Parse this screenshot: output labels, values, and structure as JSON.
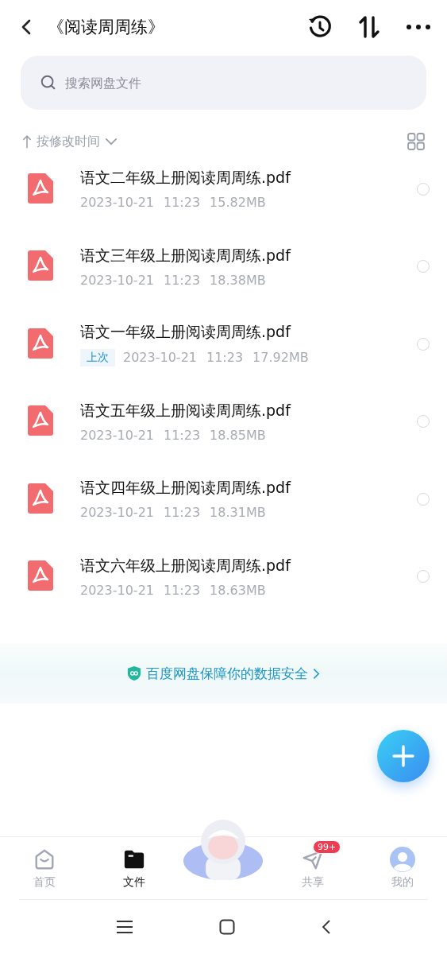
{
  "header": {
    "title": "《阅读周周练》"
  },
  "search": {
    "placeholder": "搜索网盘文件"
  },
  "sort": {
    "label": "按修改时间"
  },
  "files": [
    {
      "name": "语文二年级上册阅读周周练.pdf",
      "date": "2023-10-21",
      "time": "11:23",
      "size": "15.82MB",
      "selected": false
    },
    {
      "name": "语文三年级上册阅读周周练.pdf",
      "date": "2023-10-21",
      "time": "11:23",
      "size": "18.38MB",
      "selected": false
    },
    {
      "name": "语文一年级上册阅读周周练.pdf",
      "tag": "上次",
      "date": "2023-10-21",
      "time": "11:23",
      "size": "17.92MB",
      "selected": false
    },
    {
      "name": "语文五年级上册阅读周周练.pdf",
      "date": "2023-10-21",
      "time": "11:23",
      "size": "18.85MB",
      "selected": false
    },
    {
      "name": "语文四年级上册阅读周周练.pdf",
      "date": "2023-10-21",
      "time": "11:23",
      "size": "18.31MB",
      "selected": false
    },
    {
      "name": "语文六年级上册阅读周周练.pdf",
      "date": "2023-10-21",
      "time": "11:23",
      "size": "18.63MB",
      "selected": false
    }
  ],
  "banner": {
    "text": "百度网盘保障你的数据安全"
  },
  "nav": [
    {
      "kind": "tab",
      "label": "首页",
      "selected": false
    },
    {
      "kind": "tab",
      "label": "文件",
      "selected": true
    },
    {
      "kind": "mascot"
    },
    {
      "kind": "tab",
      "label": "共享",
      "selected": false,
      "badge": "99+"
    },
    {
      "kind": "tab",
      "label": "我的",
      "selected": false
    }
  ]
}
